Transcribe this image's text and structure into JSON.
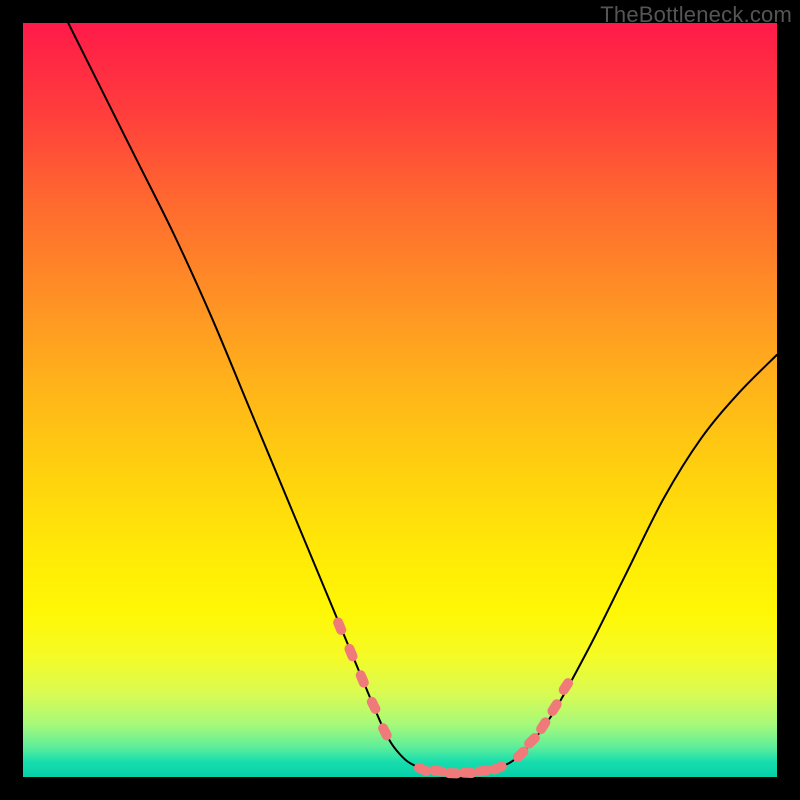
{
  "watermark": "TheBottleneck.com",
  "colors": {
    "page_bg": "#000000",
    "curve": "#000000",
    "marker": "#f07a7a",
    "gradient_top": "#ff1a49",
    "gradient_bottom": "#05d0a8"
  },
  "chart_data": {
    "type": "line",
    "title": "",
    "xlabel": "",
    "ylabel": "",
    "xlim": [
      0,
      100
    ],
    "ylim": [
      0,
      100
    ],
    "curve": {
      "name": "bottleneck-curve",
      "x": [
        6,
        10,
        15,
        20,
        25,
        30,
        35,
        40,
        45,
        48,
        50,
        52,
        55,
        58,
        60,
        63,
        66,
        70,
        75,
        80,
        85,
        90,
        95,
        100
      ],
      "y": [
        100,
        92,
        82,
        72,
        61,
        49,
        37,
        25,
        13,
        6,
        3,
        1.5,
        0.8,
        0.5,
        0.6,
        1.2,
        3,
        8,
        17,
        27,
        37,
        45,
        51,
        56
      ]
    },
    "markers": {
      "name": "highlight-points",
      "x": [
        42,
        43.5,
        45,
        46.5,
        48,
        53,
        55,
        57,
        59,
        61,
        63,
        66,
        67.5,
        69,
        70.5,
        72
      ],
      "y": [
        20,
        16.5,
        13,
        9.5,
        6,
        1.0,
        0.8,
        0.5,
        0.55,
        0.8,
        1.2,
        3.0,
        4.8,
        6.8,
        9.2,
        12
      ]
    }
  }
}
